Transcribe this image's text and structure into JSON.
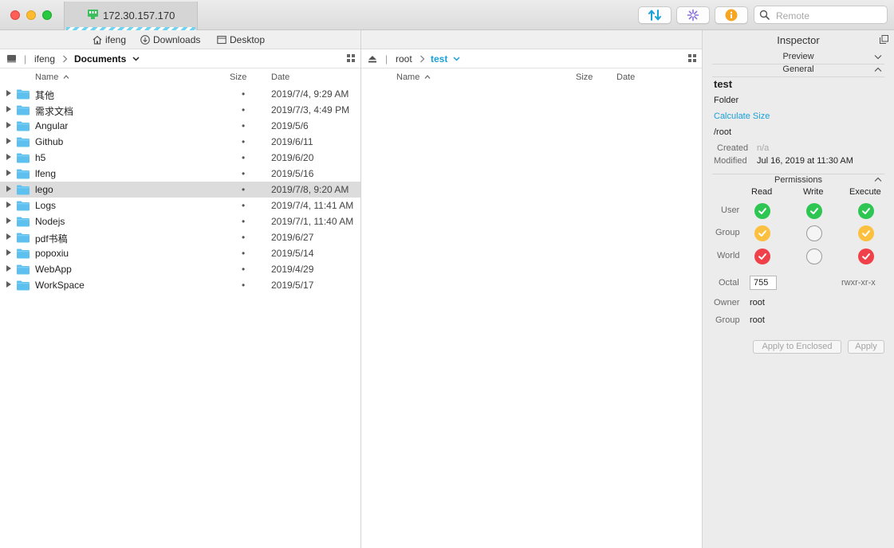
{
  "connection": {
    "title": "172.30.157.170"
  },
  "toolbar": {
    "transfer_icon": "transfer-arrows-icon",
    "activity_icon": "activity-spinner-icon",
    "info_icon": "info-icon",
    "search_placeholder": "Remote"
  },
  "favorites": [
    {
      "label": "ifeng",
      "icon": "home-icon"
    },
    {
      "label": "Downloads",
      "icon": "downloads-icon"
    },
    {
      "label": "Desktop",
      "icon": "desktop-icon"
    }
  ],
  "local": {
    "path": {
      "root": "ifeng",
      "current": "Documents"
    },
    "columns": {
      "name": "Name",
      "size": "Size",
      "date": "Date"
    },
    "rows": [
      {
        "name": "其他",
        "size": "•",
        "date": "2019/7/4, 9:29 AM"
      },
      {
        "name": "需求文档",
        "size": "•",
        "date": "2019/7/3, 4:49 PM"
      },
      {
        "name": "Angular",
        "size": "•",
        "date": "2019/5/6"
      },
      {
        "name": "Github",
        "size": "•",
        "date": "2019/6/11"
      },
      {
        "name": "h5",
        "size": "•",
        "date": "2019/6/20"
      },
      {
        "name": "lfeng",
        "size": "•",
        "date": "2019/5/16"
      },
      {
        "name": "lego",
        "size": "•",
        "date": "2019/7/8, 9:20 AM",
        "selected": true
      },
      {
        "name": "Logs",
        "size": "•",
        "date": "2019/7/4, 11:41 AM"
      },
      {
        "name": "Nodejs",
        "size": "•",
        "date": "2019/7/1, 11:40 AM"
      },
      {
        "name": "pdf书稿",
        "size": "•",
        "date": "2019/6/27"
      },
      {
        "name": "popoxiu",
        "size": "•",
        "date": "2019/5/14"
      },
      {
        "name": "WebApp",
        "size": "•",
        "date": "2019/4/29"
      },
      {
        "name": "WorkSpace",
        "size": "•",
        "date": "2019/5/17"
      }
    ]
  },
  "remote": {
    "path": {
      "root": "root",
      "current": "test"
    },
    "columns": {
      "name": "Name",
      "size": "Size",
      "date": "Date"
    }
  },
  "inspector": {
    "title": "Inspector",
    "preview_label": "Preview",
    "general_label": "General",
    "name": "test",
    "kind": "Folder",
    "calculate_size": "Calculate Size",
    "path": "/root",
    "created_label": "Created",
    "created_value": "n/a",
    "modified_label": "Modified",
    "modified_value": "Jul 16, 2019 at 11:30 AM",
    "permissions_label": "Permissions",
    "perm_columns": {
      "read": "Read",
      "write": "Write",
      "execute": "Execute"
    },
    "perm_rows": [
      {
        "label": "User",
        "read": "on",
        "write": "on",
        "execute": "on",
        "color": "#2dc653"
      },
      {
        "label": "Group",
        "read": "on",
        "write": "off",
        "execute": "on",
        "color": "#fcc03e"
      },
      {
        "label": "World",
        "read": "on",
        "write": "off",
        "execute": "on",
        "color": "#f0414a"
      }
    ],
    "octal_label": "Octal",
    "octal_value": "755",
    "mode_string": "rwxr-xr-x",
    "owner_label": "Owner",
    "owner_value": "root",
    "group_label": "Group",
    "group_value": "root",
    "apply_enclosed_label": "Apply to Enclosed",
    "apply_label": "Apply"
  },
  "colors": {
    "accent": "#1aa0d8",
    "folder": "#5ec0ee",
    "selected_row": "#dcdcdc"
  }
}
